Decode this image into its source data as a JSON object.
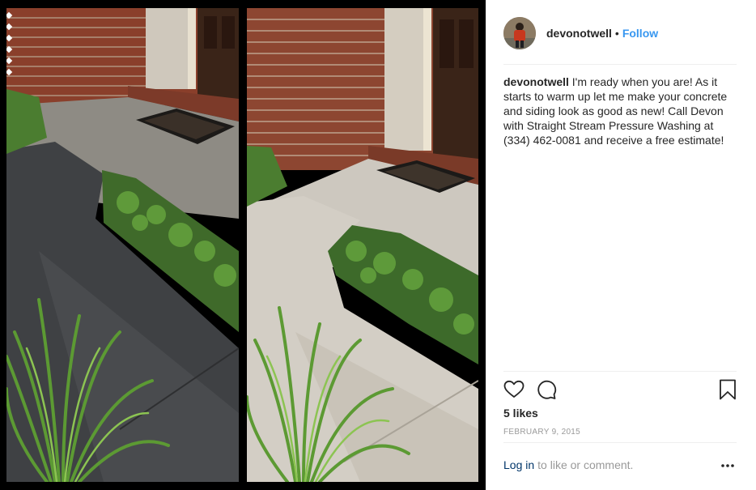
{
  "post": {
    "username": "devonotwell",
    "separator": "•",
    "follow_label": "Follow",
    "caption_user": "devonotwell",
    "caption_text": "I'm ready when you are! As it starts to warm up let me make your concrete and siding look as good as new! Call Devon with Straight Stream Pressure Washing at (334) 462-0081 and receive a free estimate!",
    "likes": "5 likes",
    "date": "FEBRUARY 9, 2015"
  },
  "footer": {
    "login_label": "Log in",
    "login_rest": "to like or comment."
  },
  "icons": {
    "like": "heart-outline-icon",
    "comment": "speech-bubble-icon",
    "save": "bookmark-icon",
    "more": "more-options-icon"
  },
  "colors": {
    "link_blue": "#3897f0",
    "login_navy": "#003569",
    "text": "#262626",
    "muted": "#999999"
  }
}
